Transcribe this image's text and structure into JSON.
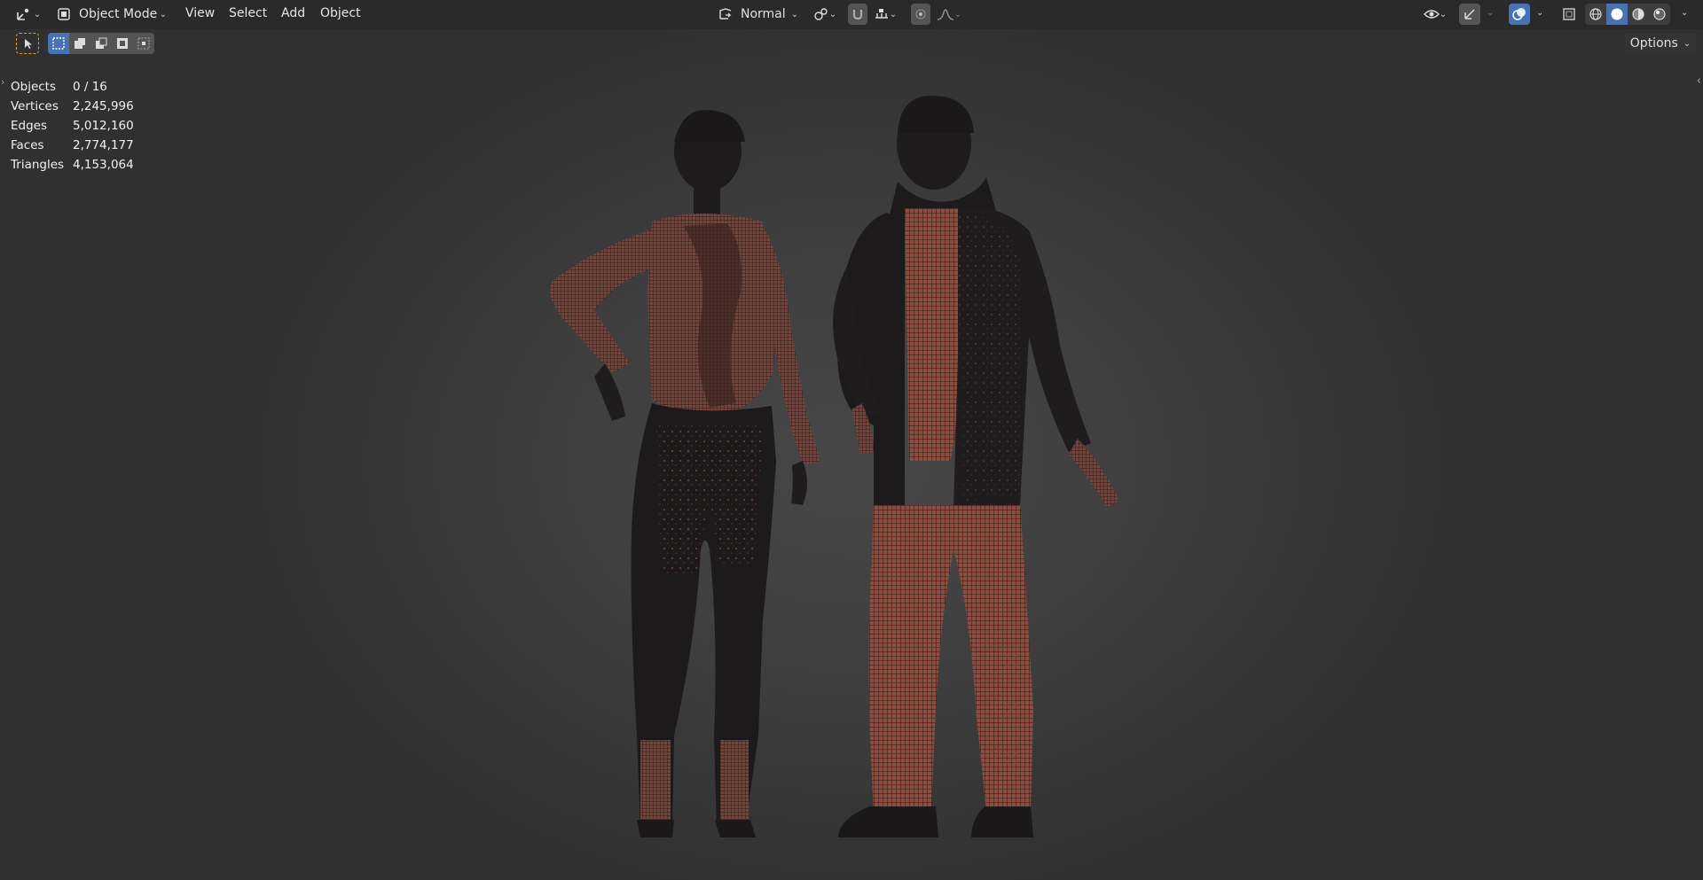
{
  "header": {
    "mode_label": "Object Mode",
    "menus": [
      "View",
      "Select",
      "Add",
      "Object"
    ],
    "orientation_label": "Normal",
    "options_label": "Options"
  },
  "stats": [
    {
      "label": "Objects",
      "value": "0 / 16"
    },
    {
      "label": "Vertices",
      "value": "2,245,996"
    },
    {
      "label": "Edges",
      "value": "5,012,160"
    },
    {
      "label": "Faces",
      "value": "2,774,177"
    },
    {
      "label": "Triangles",
      "value": "4,153,064"
    }
  ],
  "icons": {
    "editor_type": "transform-gizmo-icon",
    "mode": "object-mode-icon",
    "transform_orientation": "orientation-icon",
    "pivot": "pivot-point-icon",
    "snap": "snap-magnet-icon",
    "snap_increment": "snap-increment-icon",
    "proportional": "proportional-editing-icon",
    "falloff": "falloff-curve-icon",
    "visibility": "eye-icon",
    "gizmo": "gizmo-icon",
    "overlays": "overlays-icon",
    "xray": "xray-icon",
    "shading_modes": [
      "wireframe-shading-icon",
      "solid-shading-icon",
      "material-shading-icon",
      "rendered-shading-icon"
    ]
  },
  "colors": {
    "accent": "#4772b3",
    "header_bg": "#2a2a2a",
    "viewport_center": "#474747",
    "mesh_dark": "#1c1a1a",
    "mesh_wire": "#9a5a4e"
  }
}
